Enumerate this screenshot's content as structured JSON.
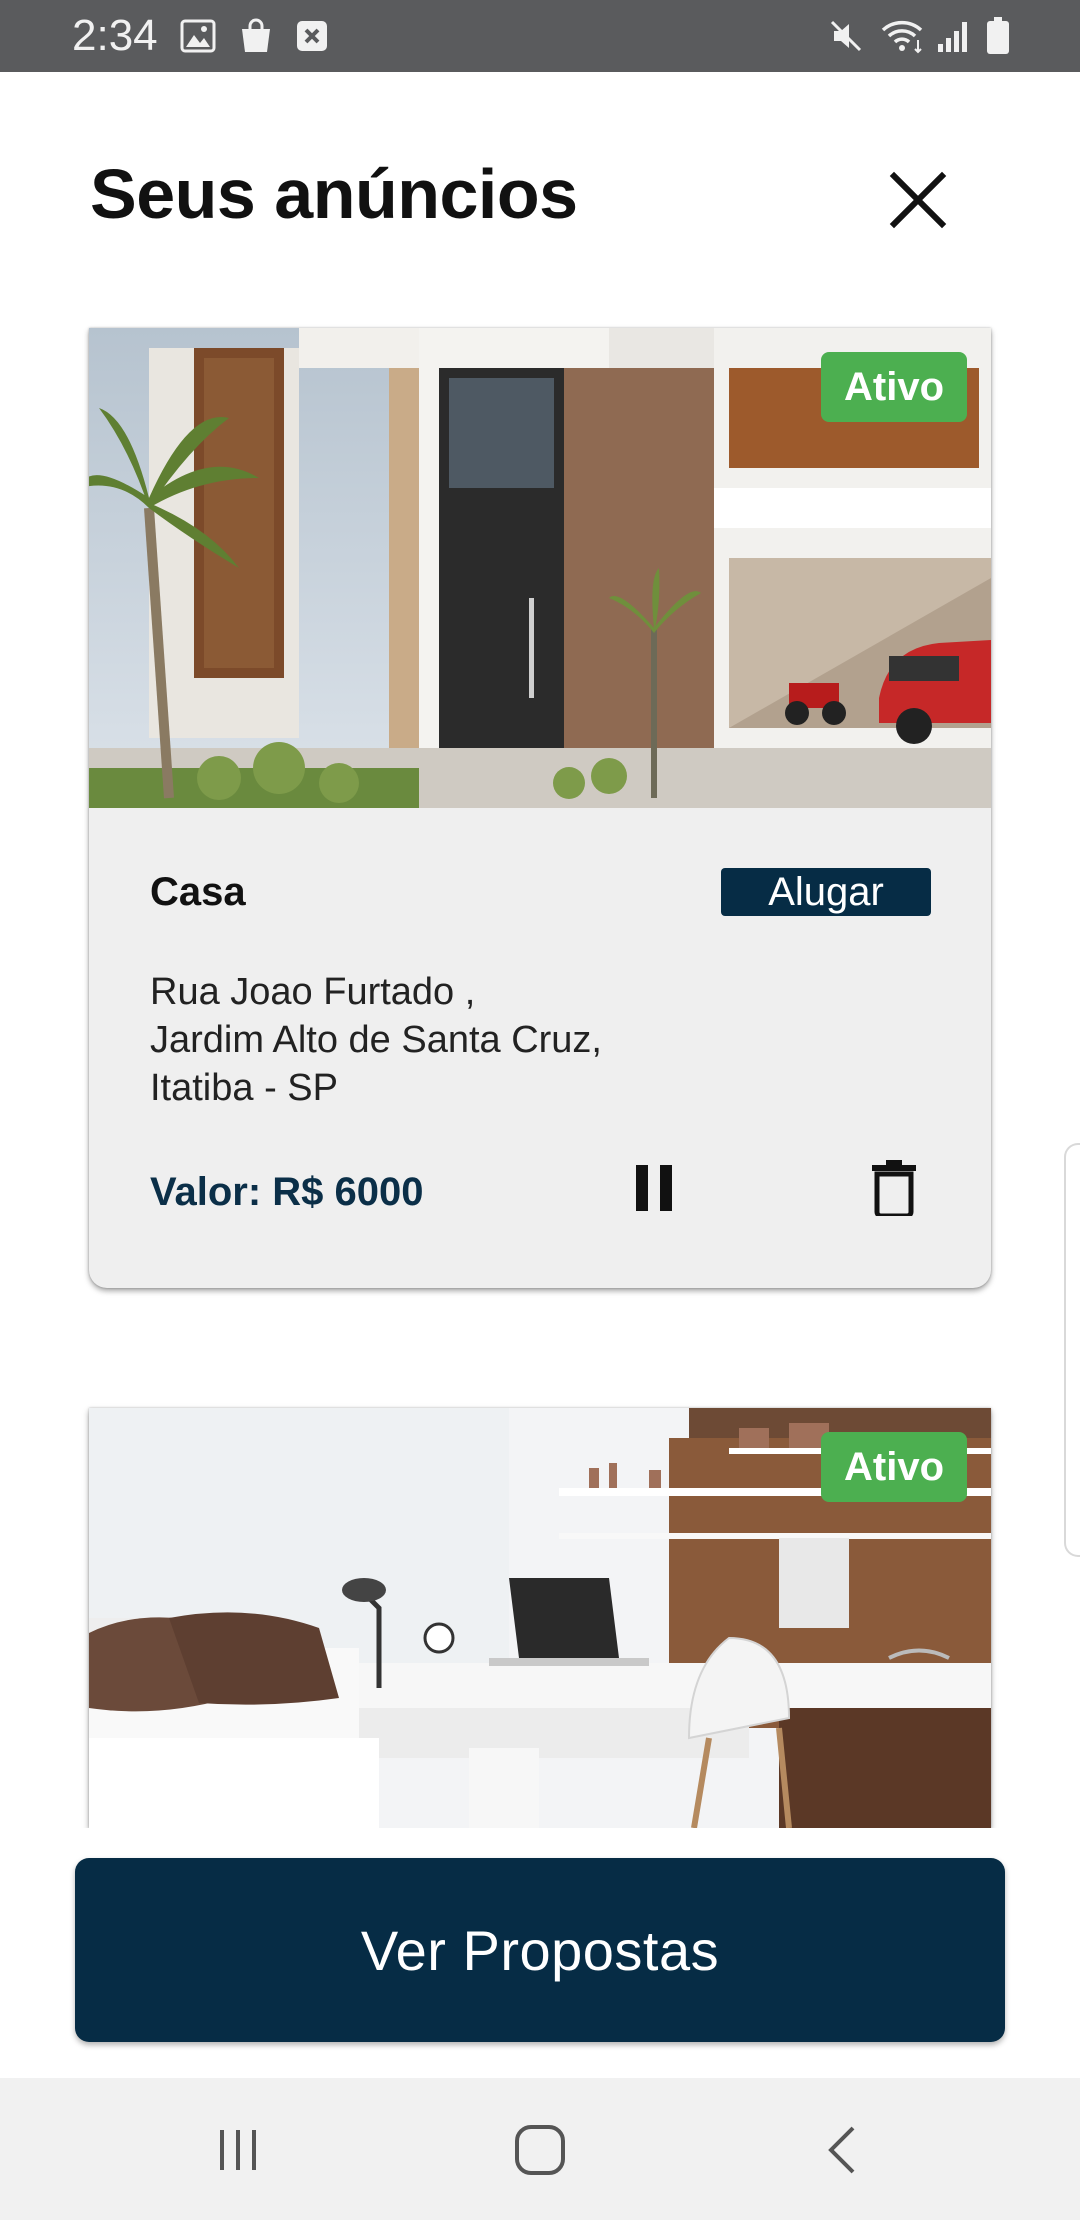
{
  "status_bar": {
    "time": "2:34",
    "left_icons": [
      "image-icon",
      "shopping-bag-icon",
      "close-box-icon"
    ],
    "right_icons": [
      "mute-icon",
      "wifi-icon",
      "signal-icon",
      "battery-icon"
    ]
  },
  "header": {
    "title": "Seus anúncios",
    "close_icon": "close-icon"
  },
  "listings": [
    {
      "status": "Ativo",
      "type": "Casa",
      "deal": "Alugar",
      "address_lines": [
        "Rua Joao Furtado ,",
        "Jardim Alto de Santa Cruz,",
        "Itatiba - SP"
      ],
      "price": "Valor: R$ 6000",
      "actions": [
        "pause-icon",
        "trash-icon"
      ]
    },
    {
      "status": "Ativo"
    }
  ],
  "cta": {
    "label": "Ver Propostas"
  },
  "colors": {
    "primary": "#062c45",
    "active_badge": "#4caf50",
    "status_bar": "#5a5b5d",
    "card_bg": "#efefef"
  },
  "navbar": {
    "icons": [
      "recent-apps-icon",
      "home-icon",
      "back-icon"
    ]
  }
}
